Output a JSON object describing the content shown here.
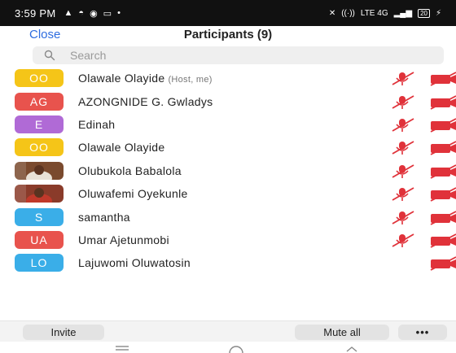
{
  "status_bar": {
    "time": "3:59 PM",
    "icons": [
      "▲",
      "◓",
      "◉",
      "▭",
      "•"
    ],
    "network": "LTE 4G",
    "battery": "20"
  },
  "header": {
    "close_label": "Close",
    "title": "Participants (9)"
  },
  "search": {
    "placeholder": "Search"
  },
  "participants": [
    {
      "initials": "OO",
      "color": "#f5c518",
      "name": "Olawale Olayide",
      "note": "(Host, me)",
      "mic": true,
      "cam": true
    },
    {
      "initials": "AG",
      "color": "#e8534d",
      "name": "AZONGNIDE G. Gwladys",
      "note": "",
      "mic": true,
      "cam": true
    },
    {
      "initials": "E",
      "color": "#b06ad6",
      "name": "Edinah",
      "note": "",
      "mic": true,
      "cam": true
    },
    {
      "initials": "OO",
      "color": "#f5c518",
      "name": "Olawale Olayide",
      "note": "",
      "mic": true,
      "cam": true
    },
    {
      "initials": "",
      "color": "#7a4a2e",
      "name": "Olubukola Babalola",
      "note": "",
      "mic": true,
      "cam": true,
      "photo": true
    },
    {
      "initials": "",
      "color": "#8a3b2a",
      "name": "Oluwafemi Oyekunle",
      "note": "",
      "mic": true,
      "cam": true,
      "photo": true
    },
    {
      "initials": "S",
      "color": "#3aaee8",
      "name": "samantha",
      "note": "",
      "mic": true,
      "cam": true
    },
    {
      "initials": "UA",
      "color": "#e8534d",
      "name": "Umar Ajetunmobi",
      "note": "",
      "mic": true,
      "cam": true
    },
    {
      "initials": "LO",
      "color": "#3aaee8",
      "name": "Lajuwomi Oluwatosin",
      "note": "",
      "mic": false,
      "cam": true
    }
  ],
  "footer": {
    "invite_label": "Invite",
    "mute_all_label": "Mute all",
    "more_label": "•••"
  },
  "colors": {
    "accent": "#2d6cdf",
    "muted_red": "#e0323a"
  }
}
